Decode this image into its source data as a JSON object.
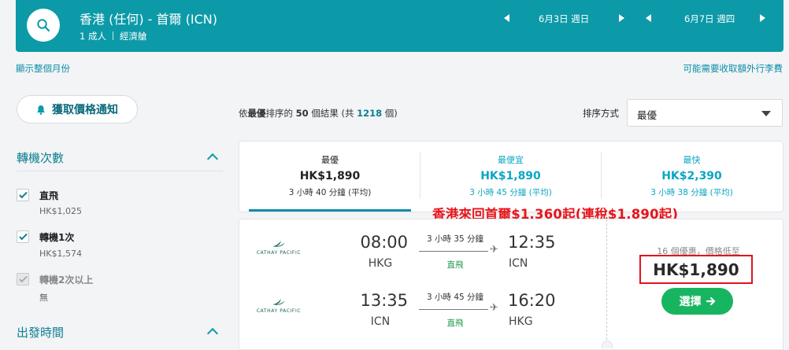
{
  "header": {
    "route": "香港 (任何) - 首爾 (ICN)",
    "passengers": "1 成人",
    "cabin": "經濟艙",
    "depart_date": "6月3日 週日",
    "return_date": "6月7日 週四",
    "colors": {
      "bar": "#0c9aa8"
    }
  },
  "links": {
    "show_month": "顯示整個月份",
    "baggage_fee": "可能需要收取額外行李費"
  },
  "sidebar": {
    "price_alert": "獲取價格通知",
    "stops_title": "轉機次數",
    "stops": [
      {
        "label": "直飛",
        "price": "HK$1,025",
        "checked": true,
        "disabled": false
      },
      {
        "label": "轉機1次",
        "price": "HK$1,574",
        "checked": true,
        "disabled": false
      },
      {
        "label": "轉機2次以上",
        "price": "無",
        "checked": true,
        "disabled": true
      }
    ],
    "departure_title": "出發時間"
  },
  "results": {
    "summary_prefix": "依",
    "summary_sort": "最優",
    "summary_mid": "排序的",
    "summary_count": "50",
    "summary_after": " 個結果 (共 ",
    "summary_total": "1218",
    "summary_end": " 個)",
    "sort_label": "排序方式",
    "sort_value": "最優"
  },
  "tabs": [
    {
      "title": "最優",
      "price": "HK$1,890",
      "duration": "3 小時 40 分鐘 (平均)"
    },
    {
      "title": "最便宜",
      "price": "HK$1,890",
      "duration": "3 小時 45 分鐘 (平均)"
    },
    {
      "title": "最快",
      "price": "HK$2,390",
      "duration": "3 小時 38 分鐘 (平均)"
    }
  ],
  "promo": "香港來回首爾$1,360起(連稅$1,890起)",
  "flight": {
    "airline": "CATHAY PACIFIC",
    "outbound": {
      "dep_time": "08:00",
      "dep_code": "HKG",
      "arr_time": "12:35",
      "arr_code": "ICN",
      "duration": "3 小時 35 分鐘",
      "stops": "直飛"
    },
    "inbound": {
      "dep_time": "13:35",
      "dep_code": "ICN",
      "arr_time": "16:20",
      "arr_code": "HKG",
      "duration": "3 小時 45 分鐘",
      "stops": "直飛"
    },
    "deals": "16 個優惠，價格低至",
    "price": "HK$1,890",
    "select": "選擇"
  }
}
